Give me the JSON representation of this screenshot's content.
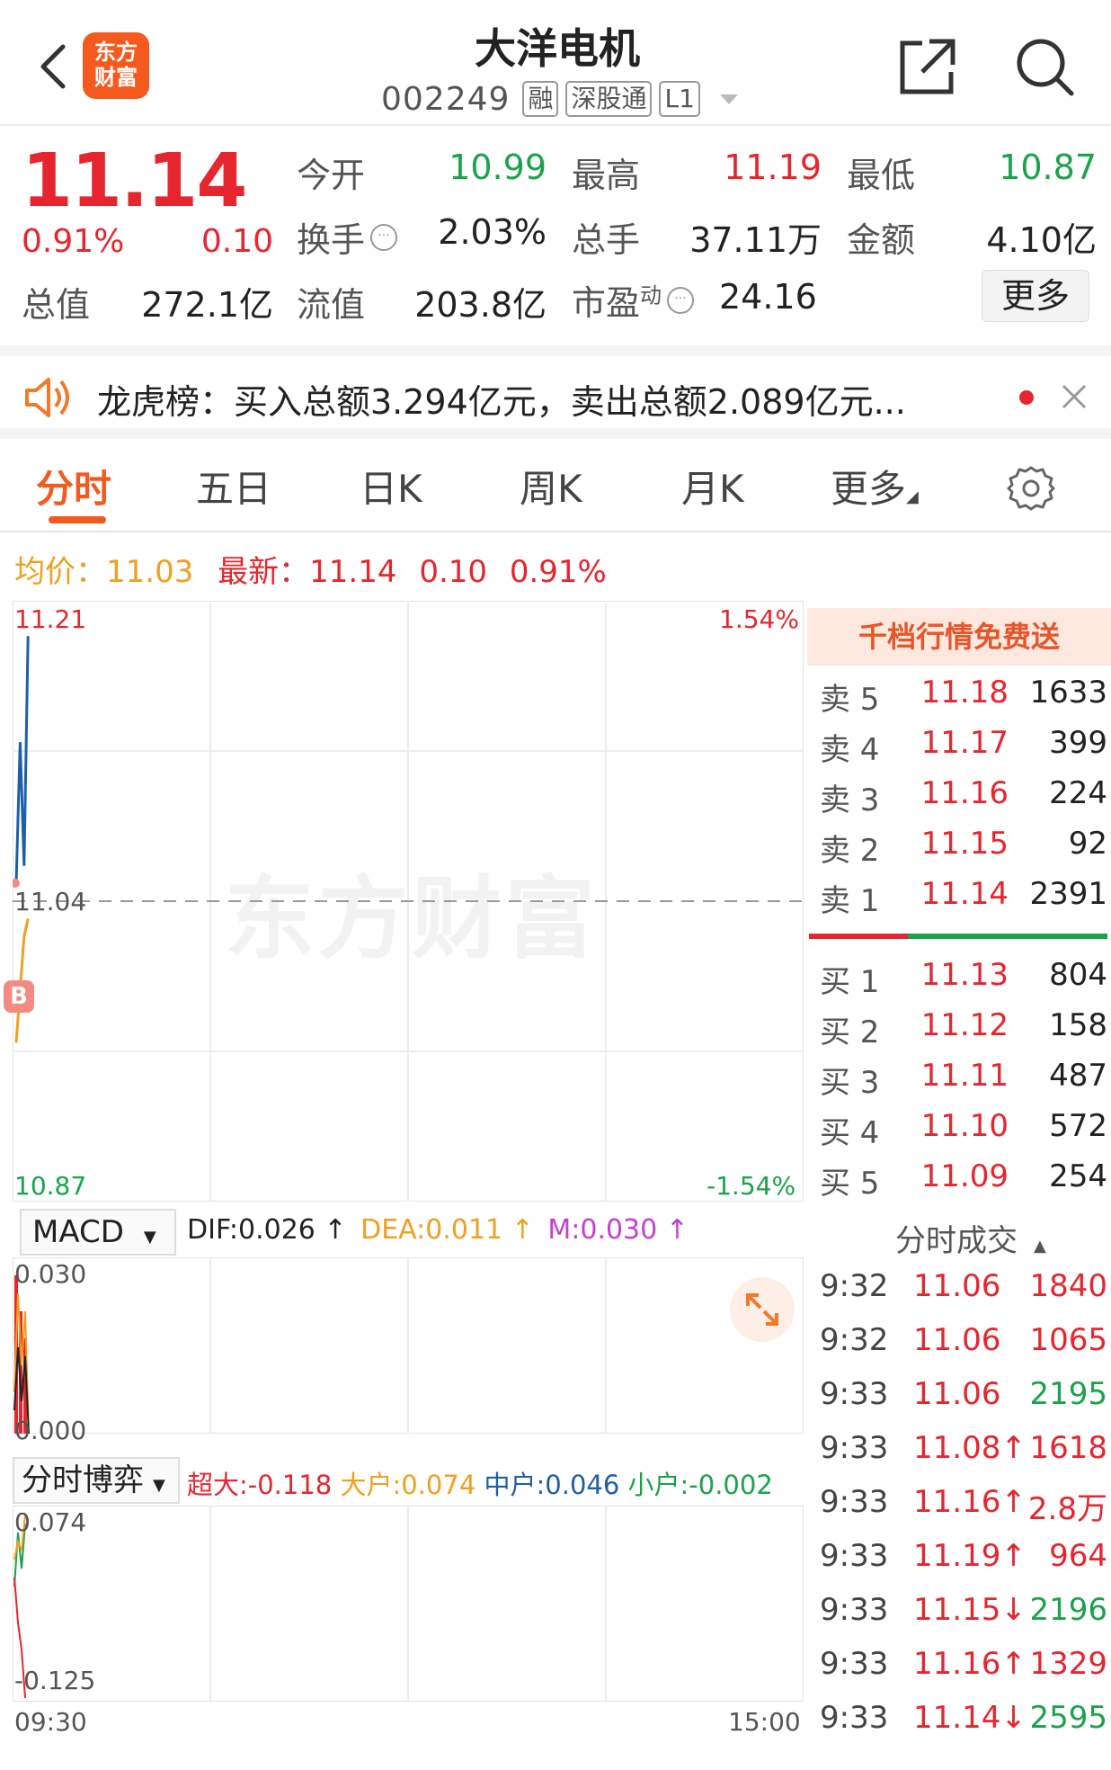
{
  "header": {
    "title": "大洋电机",
    "logo_text_1": "东方",
    "logo_text_2": "财富",
    "code": "002249",
    "tags": [
      "融",
      "深股通",
      "L1"
    ]
  },
  "quote": {
    "price": "11.14",
    "change_pct": "0.91%",
    "change": "0.10",
    "open_label": "今开",
    "open": "10.99",
    "high_label": "最高",
    "high": "11.19",
    "low_label": "最低",
    "low": "10.87",
    "turnover_label": "换手",
    "turnover": "2.03%",
    "volume_label": "总手",
    "volume": "37.11万",
    "amount_label": "金额",
    "amount": "4.10亿",
    "total_mv_label": "总值",
    "total_mv": "272.1亿",
    "float_mv_label": "流值",
    "float_mv": "203.8亿",
    "pe_label": "市盈",
    "pe_sup": "动",
    "pe": "24.16",
    "more_label": "更多"
  },
  "notice": {
    "text": "龙虎榜：买入总额3.294亿元，卖出总额2.089亿元..."
  },
  "tabs": [
    "分时",
    "五日",
    "日K",
    "周K",
    "月K",
    "更多"
  ],
  "summary": {
    "avg_label": "均价：",
    "avg": "11.03",
    "latest_label": "最新：",
    "latest": "11.14",
    "change": "0.10",
    "change_pct": "0.91%"
  },
  "chart": {
    "y_top": "11.21",
    "y_mid": "11.04",
    "y_bottom": "10.87",
    "pct_top": "1.54%",
    "pct_bottom": "-1.54%",
    "watermark": "东方财富",
    "b_marker": "B",
    "time_start": "09:30",
    "time_end": "15:00"
  },
  "chart_data": {
    "type": "line",
    "title": "",
    "x_range": [
      "09:30",
      "15:00"
    ],
    "ylim": [
      10.87,
      11.21
    ],
    "reference": 11.04,
    "series": [
      {
        "name": "",
        "color": "#1f5fa8",
        "x": [
          "09:30",
          "09:31",
          "09:32",
          "09:33"
        ],
        "values": [
          11.05,
          11.13,
          11.06,
          11.19
        ]
      },
      {
        "name": "",
        "color": "#f0a020",
        "x": [
          "09:30",
          "09:31",
          "09:32",
          "09:33"
        ],
        "values": [
          10.96,
          10.99,
          11.02,
          11.03
        ]
      }
    ]
  },
  "macd": {
    "select": "MACD",
    "dif": "DIF:0.026",
    "dea": "DEA:0.011",
    "m": "M:0.030",
    "y_top": "0.030",
    "y_bottom": "0.000"
  },
  "bout": {
    "select": "分时博弈",
    "super": "超大:-0.118",
    "big": "大户:0.074",
    "mid": "中户:0.046",
    "small": "小户:-0.002",
    "y_top": "0.074",
    "y_bottom": "-0.125"
  },
  "orderbook": {
    "promo": "千档行情免费送",
    "sells": [
      {
        "label": "卖 5",
        "price": "11.18",
        "vol": "1633"
      },
      {
        "label": "卖 4",
        "price": "11.17",
        "vol": "399"
      },
      {
        "label": "卖 3",
        "price": "11.16",
        "vol": "224"
      },
      {
        "label": "卖 2",
        "price": "11.15",
        "vol": "92"
      },
      {
        "label": "卖 1",
        "price": "11.14",
        "vol": "2391"
      }
    ],
    "buys": [
      {
        "label": "买 1",
        "price": "11.13",
        "vol": "804"
      },
      {
        "label": "买 2",
        "price": "11.12",
        "vol": "158"
      },
      {
        "label": "买 3",
        "price": "11.11",
        "vol": "487"
      },
      {
        "label": "买 4",
        "price": "11.10",
        "vol": "572"
      },
      {
        "label": "买 5",
        "price": "11.09",
        "vol": "254"
      }
    ]
  },
  "ticks": {
    "title": "分时成交",
    "rows": [
      {
        "time": "9:32",
        "price": "11.06",
        "vol": "1840",
        "dir": "buy"
      },
      {
        "time": "9:32",
        "price": "11.06",
        "vol": "1065",
        "dir": "buy"
      },
      {
        "time": "9:33",
        "price": "11.06",
        "vol": "2195",
        "dir": "sell"
      },
      {
        "time": "9:33",
        "price": "11.08↑",
        "vol": "1618",
        "dir": "buy"
      },
      {
        "time": "9:33",
        "price": "11.16↑",
        "vol": "2.8万",
        "dir": "buy"
      },
      {
        "time": "9:33",
        "price": "11.19↑",
        "vol": "964",
        "dir": "buy"
      },
      {
        "time": "9:33",
        "price": "11.15↓",
        "vol": "2196",
        "dir": "sell"
      },
      {
        "time": "9:33",
        "price": "11.16↑",
        "vol": "1329",
        "dir": "buy"
      },
      {
        "time": "9:33",
        "price": "11.14↓",
        "vol": "2595",
        "dir": "sell"
      }
    ]
  }
}
